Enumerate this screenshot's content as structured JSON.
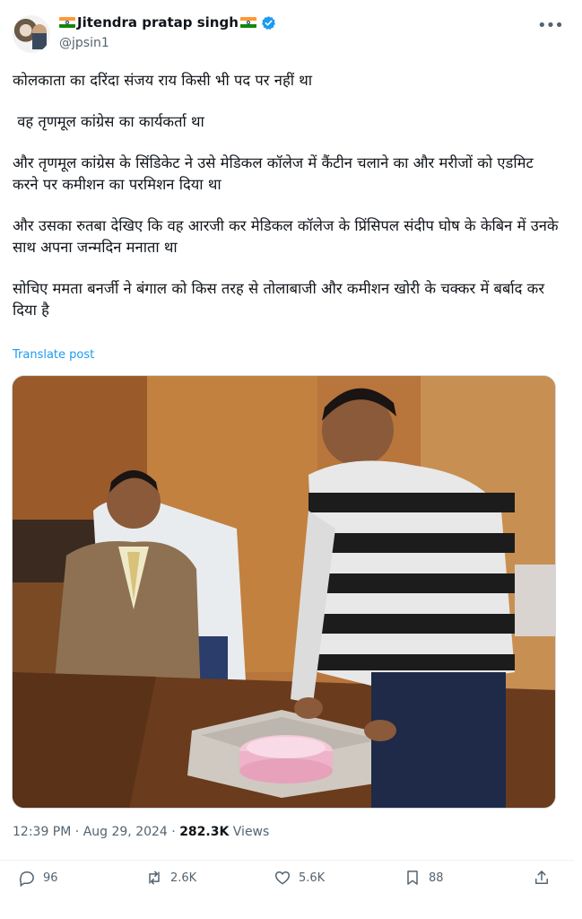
{
  "author": {
    "display_name": "Jitendra pratap singh",
    "handle": "@jpsin1"
  },
  "more_label": "•••",
  "post": {
    "paragraphs": [
      "कोलकाता का दरिंदा संजय राय किसी भी पद पर नहीं था",
      " वह तृणमूल कांग्रेस का कार्यकर्ता था",
      "और तृणमूल कांग्रेस के सिंडिकेट ने उसे मेडिकल कॉलेज में कैंटीन चलाने का और मरीजों को एडमिट करने पर कमीशन का परमिशन दिया था",
      "और उसका रुतबा देखिए कि वह आरजी कर मेडिकल कॉलेज के प्रिंसिपल संदीप घोष के केबिन में उनके साथ अपना जन्मदिन मनाता था",
      "सोचिए ममता बनर्जी ने बंगाल को किस तरह से तोलाबाजी और कमीशन खोरी के चक्कर में बर्बाद कर दिया है"
    ],
    "translate_label": "Translate post"
  },
  "meta": {
    "time": "12:39 PM",
    "separator": " · ",
    "date": "Aug 29, 2024",
    "views_count": "282.3K",
    "views_label": " Views"
  },
  "actions": {
    "replies": "96",
    "reposts": "2.6K",
    "likes": "5.6K",
    "bookmarks": "88"
  },
  "colors": {
    "accent": "#1d9bf0",
    "text": "#0f1419",
    "muted": "#536471"
  }
}
